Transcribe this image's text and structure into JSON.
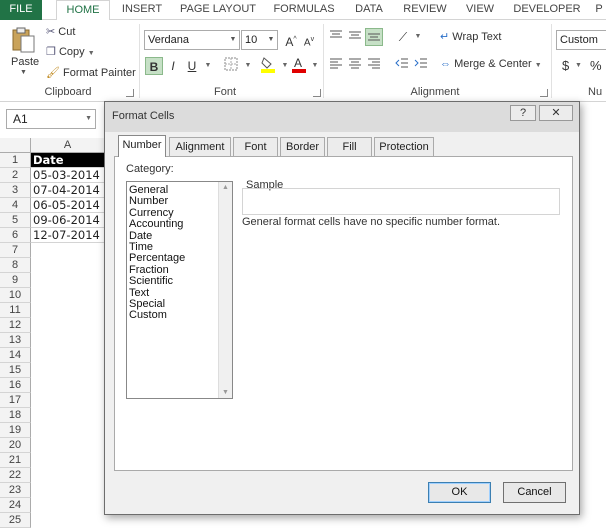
{
  "ribbon_tabs": [
    "FILE",
    "HOME",
    "INSERT",
    "PAGE LAYOUT",
    "FORMULAS",
    "DATA",
    "REVIEW",
    "VIEW",
    "DEVELOPER",
    "P"
  ],
  "clipboard": {
    "paste": "Paste",
    "cut": "Cut",
    "copy": "Copy",
    "format_painter": "Format Painter",
    "label": "Clipboard"
  },
  "font": {
    "name": "Verdana",
    "size": "10",
    "bold": "B",
    "italic": "I",
    "underline": "U",
    "label": "Font"
  },
  "alignment": {
    "wrap_text": "Wrap Text",
    "merge_center": "Merge & Center",
    "label": "Alignment"
  },
  "number": {
    "format": "Custom",
    "currency": "$",
    "percent": "%",
    "label": "Nu"
  },
  "namebox": "A1",
  "sheet": {
    "col_header": "A",
    "rows": [
      "1",
      "2",
      "3",
      "4",
      "5",
      "6",
      "7",
      "8",
      "9",
      "10",
      "11",
      "12",
      "13",
      "14",
      "15",
      "16",
      "17",
      "18",
      "19",
      "20",
      "21",
      "22",
      "23",
      "24",
      "25"
    ],
    "cells": [
      "Date",
      "05-03-2014",
      "07-04-2014",
      "06-05-2014",
      "09-06-2014",
      "12-07-2014"
    ]
  },
  "dialog": {
    "title": "Format Cells",
    "help": "?",
    "close": "✕",
    "tabs": [
      "Number",
      "Alignment",
      "Font",
      "Border",
      "Fill",
      "Protection"
    ],
    "category_label": "Category:",
    "categories": [
      "General",
      "Number",
      "Currency",
      "Accounting",
      "Date",
      "Time",
      "Percentage",
      "Fraction",
      "Scientific",
      "Text",
      "Special",
      "Custom"
    ],
    "sample_label": "Sample",
    "description": "General format cells have no specific number format.",
    "ok": "OK",
    "cancel": "Cancel"
  }
}
